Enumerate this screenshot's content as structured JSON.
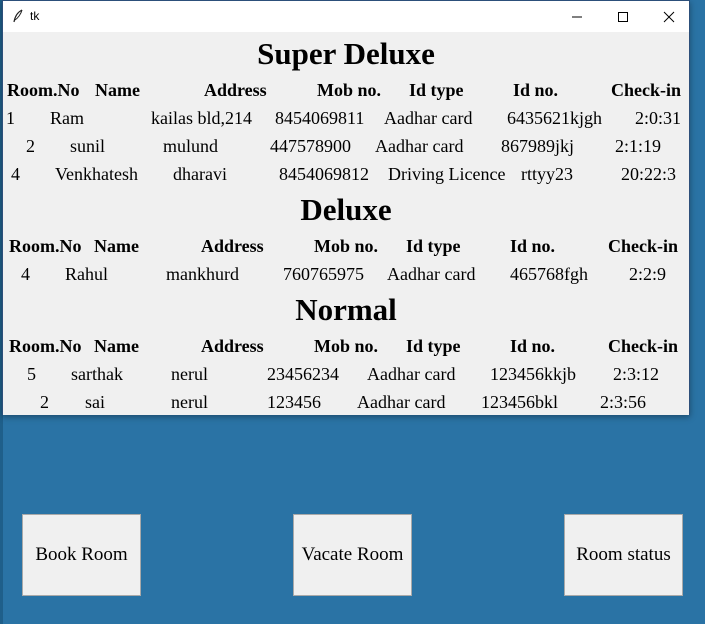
{
  "window": {
    "title": "tk"
  },
  "sections": {
    "super_deluxe": {
      "title": "Super Deluxe",
      "headers": [
        "Room.No",
        "Name",
        "Address",
        "Mob no.",
        "Id type",
        "Id no.",
        "Check-in"
      ],
      "rows": [
        [
          "1",
          "Ram",
          "kailas bld,214",
          "8454069811",
          "Aadhar card",
          "6435621kjgh",
          "2:0:31"
        ],
        [
          "2",
          "sunil",
          "mulund",
          "447578900",
          "Aadhar card",
          "867989jkj",
          "2:1:19"
        ],
        [
          "4",
          "Venkhatesh",
          "dharavi",
          "8454069812",
          "Driving Licence",
          "rttyy23",
          "20:22:3"
        ]
      ]
    },
    "deluxe": {
      "title": "Deluxe",
      "headers": [
        "Room.No",
        "Name",
        "Address",
        "Mob no.",
        "Id type",
        "Id no.",
        "Check-in"
      ],
      "rows": [
        [
          "4",
          "Rahul",
          "mankhurd",
          "760765975",
          "Aadhar card",
          "465768fgh",
          "2:2:9"
        ]
      ]
    },
    "normal": {
      "title": "Normal",
      "headers": [
        "Room.No",
        "Name",
        "Address",
        "Mob no.",
        "Id type",
        "Id no.",
        "Check-in"
      ],
      "rows": [
        [
          "5",
          "sarthak",
          "nerul",
          "23456234",
          "Aadhar card",
          "123456kkjb",
          "2:3:12"
        ],
        [
          "2",
          "sai",
          "nerul",
          "123456",
          "Aadhar card",
          "123456bkl",
          "2:3:56"
        ]
      ]
    }
  },
  "buttons": {
    "book": "Book Room",
    "vacate": "Vacate Room",
    "status": "Room status"
  },
  "colors": {
    "desktop": "#2a73a5",
    "window_bg": "#f0f0f0",
    "button_bg": "#f0f0f0"
  }
}
